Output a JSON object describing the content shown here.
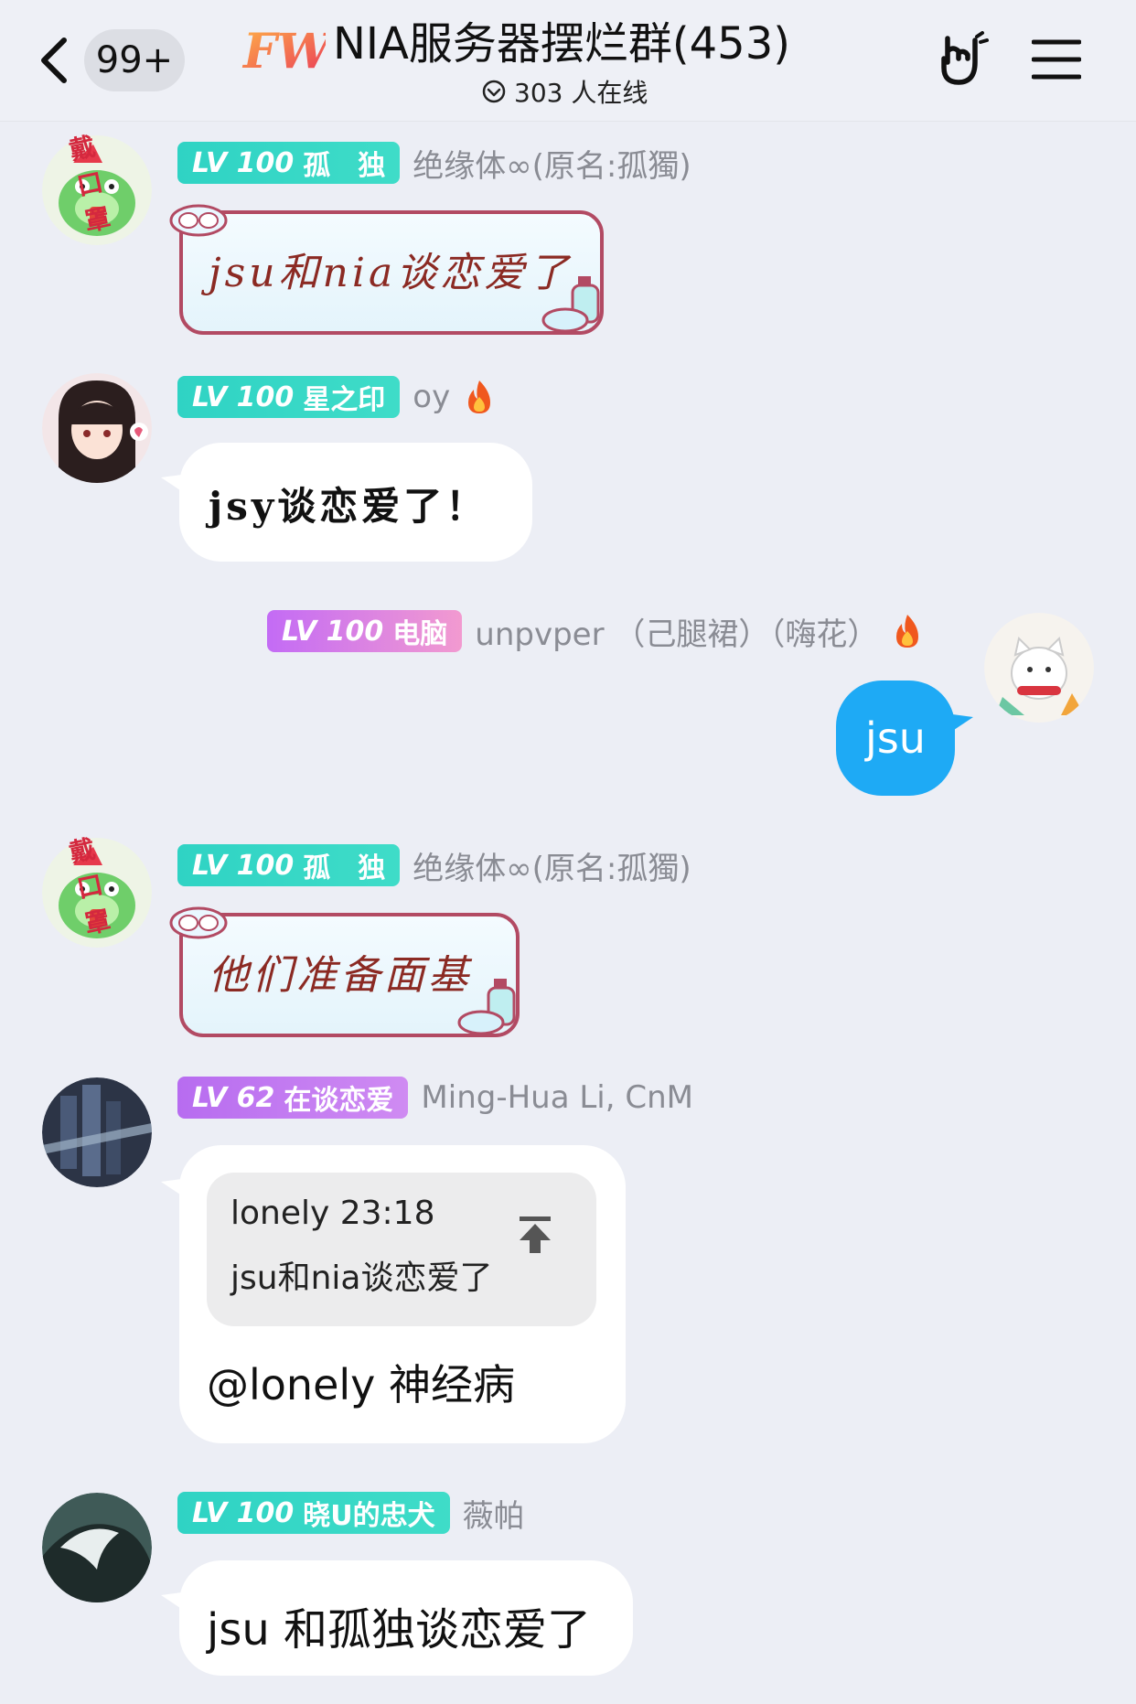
{
  "header": {
    "unread_count": "99+",
    "group_logo": "FW",
    "group_title": "NIA服务器摆烂群(453)",
    "online_text": "303 人在线"
  },
  "messages": [
    {
      "level": "LV 100",
      "badge_title": "孤　独",
      "badge_color": "#33d6c6",
      "nickname": "绝缘体∞(原名:孤獨)",
      "avatar_sticker": "戴口罩",
      "text": "jsu和nia谈恋爱了",
      "style": "decorated"
    },
    {
      "level": "LV 100",
      "badge_title": "星之印",
      "badge_color": "#33d6c6",
      "nickname": "oy",
      "text": "jsy谈恋爱了！",
      "style": "handwriting"
    },
    {
      "level": "LV 100",
      "badge_title": "电脑",
      "badge_color": "#c36bf5",
      "nickname": "unpvper （己腿裙）（嗨花）",
      "text": "jsu",
      "style": "self"
    },
    {
      "level": "LV 100",
      "badge_title": "孤　独",
      "badge_color": "#33d6c6",
      "nickname": "绝缘体∞(原名:孤獨)",
      "avatar_sticker": "戴口罩",
      "text": "他们准备面基",
      "style": "decorated"
    },
    {
      "level": "LV 62",
      "badge_title": "在谈恋爱",
      "badge_color": "#b76cf0",
      "nickname": "Ming-Hua Li, CnM",
      "quote_author_time": "lonely 23:18",
      "quote_text": "jsu和nia谈恋爱了",
      "text": "@lonely 神经病",
      "style": "reply"
    },
    {
      "level": "LV 100",
      "badge_title": "晓U的忠犬",
      "badge_color": "#33d6c6",
      "nickname": "薇帕",
      "text": "jsu 和孤独谈恋爱了",
      "style": "plain"
    }
  ],
  "icons": {
    "back": "chevron-left-icon",
    "online": "check-circle-icon",
    "hand": "rock-hand-icon",
    "menu": "hamburger-menu-icon",
    "fire": "fire-icon",
    "pin": "arrow-to-top-icon"
  },
  "colors": {
    "teal_badge": "#33d6c6",
    "purple_badge": "#b76cf0",
    "self_bubble": "#1eaaf5",
    "deco_border": "#b24a63",
    "deco_text": "#8b2a23"
  }
}
